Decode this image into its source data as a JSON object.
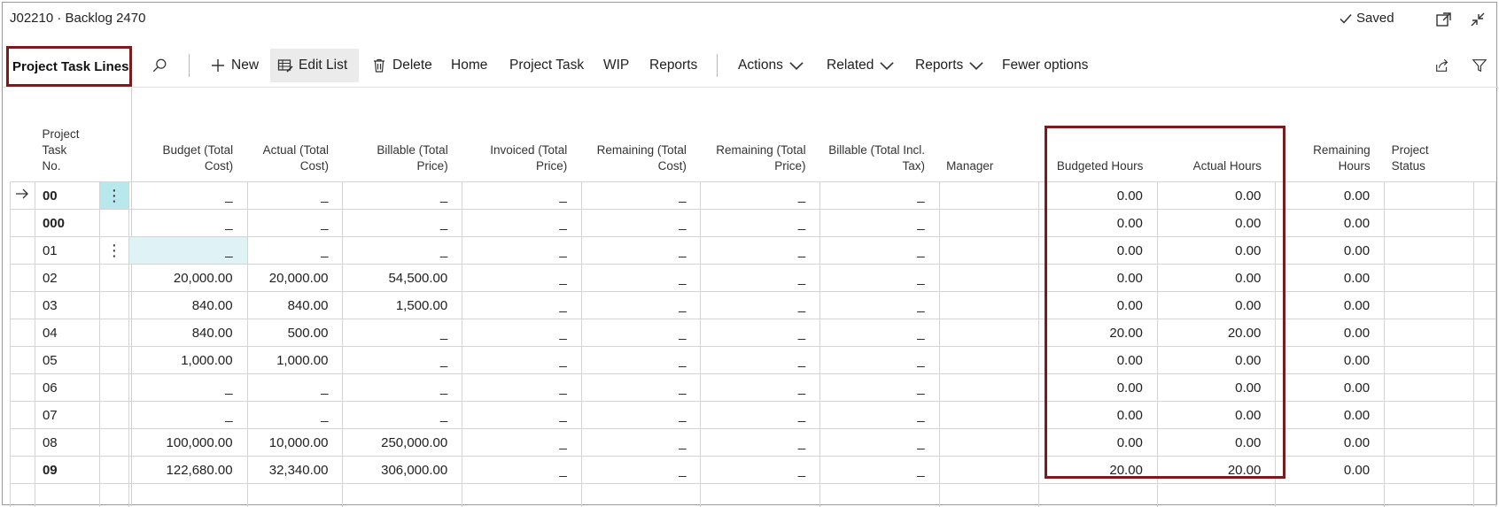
{
  "window": {
    "title": "J02210 · Backlog 2470",
    "saved_label": "Saved",
    "icons": [
      "checkmark-icon",
      "open-in-new-window-icon",
      "collapse-icon"
    ]
  },
  "actionbar": {
    "section_label": "Project Task Lines",
    "search_icon": "search-icon",
    "new_label": "New",
    "edit_list_label": "Edit List",
    "delete_label": "Delete",
    "home_label": "Home",
    "project_task_label": "Project Task",
    "wip_label": "WIP",
    "reports_label": "Reports",
    "actions_label": "Actions",
    "related_label": "Related",
    "reports_menu_label": "Reports",
    "fewer_options_label": "Fewer options",
    "share_icon": "share-icon",
    "filter_icon": "filter-icon"
  },
  "table": {
    "columns": {
      "task_no": "Project Task No.",
      "budget_cost": "Budget (Total Cost)",
      "actual_cost": "Actual (Total Cost)",
      "billable_price": "Billable (Total Price)",
      "invoiced_price": "Invoiced (Total Price)",
      "remaining_cost": "Remaining (Total Cost)",
      "remaining_price": "Remaining (Total Price)",
      "billable_incl_tax": "Billable (Total Incl. Tax)",
      "manager": "Manager",
      "budgeted_hours": "Budgeted Hours",
      "actual_hours": "Actual Hours",
      "remaining_hours": "Remaining Hours",
      "project_status": "Project Status"
    },
    "rows": [
      {
        "no": "00",
        "bold": true,
        "current": true,
        "menu": true,
        "budget": "_",
        "actual": "_",
        "billable": "_",
        "invoiced": "_",
        "rem_cost": "_",
        "rem_price": "_",
        "bill_tax": "_",
        "manager": "",
        "bud_hours": "0.00",
        "act_hours": "0.00",
        "rem_hours": "0.00",
        "status": ""
      },
      {
        "no": "000",
        "bold": true,
        "current": false,
        "menu": false,
        "budget": "_",
        "actual": "_",
        "billable": "_",
        "invoiced": "_",
        "rem_cost": "_",
        "rem_price": "_",
        "bill_tax": "_",
        "manager": "",
        "bud_hours": "0.00",
        "act_hours": "0.00",
        "rem_hours": "0.00",
        "status": ""
      },
      {
        "no": "01",
        "bold": false,
        "current": false,
        "menu": true,
        "budget": "_",
        "actual": "_",
        "billable": "_",
        "invoiced": "_",
        "rem_cost": "_",
        "rem_price": "_",
        "bill_tax": "_",
        "manager": "",
        "bud_hours": "0.00",
        "act_hours": "0.00",
        "rem_hours": "0.00",
        "status": ""
      },
      {
        "no": "02",
        "bold": false,
        "current": false,
        "menu": false,
        "budget": "20,000.00",
        "actual": "20,000.00",
        "billable": "54,500.00",
        "invoiced": "_",
        "rem_cost": "_",
        "rem_price": "_",
        "bill_tax": "_",
        "manager": "",
        "bud_hours": "0.00",
        "act_hours": "0.00",
        "rem_hours": "0.00",
        "status": ""
      },
      {
        "no": "03",
        "bold": false,
        "current": false,
        "menu": false,
        "budget": "840.00",
        "actual": "840.00",
        "billable": "1,500.00",
        "invoiced": "_",
        "rem_cost": "_",
        "rem_price": "_",
        "bill_tax": "_",
        "manager": "",
        "bud_hours": "0.00",
        "act_hours": "0.00",
        "rem_hours": "0.00",
        "status": ""
      },
      {
        "no": "04",
        "bold": false,
        "current": false,
        "menu": false,
        "budget": "840.00",
        "actual": "500.00",
        "billable": "_",
        "invoiced": "_",
        "rem_cost": "_",
        "rem_price": "_",
        "bill_tax": "_",
        "manager": "",
        "bud_hours": "20.00",
        "act_hours": "20.00",
        "rem_hours": "0.00",
        "status": ""
      },
      {
        "no": "05",
        "bold": false,
        "current": false,
        "menu": false,
        "budget": "1,000.00",
        "actual": "1,000.00",
        "billable": "_",
        "invoiced": "_",
        "rem_cost": "_",
        "rem_price": "_",
        "bill_tax": "_",
        "manager": "",
        "bud_hours": "0.00",
        "act_hours": "0.00",
        "rem_hours": "0.00",
        "status": ""
      },
      {
        "no": "06",
        "bold": false,
        "current": false,
        "menu": false,
        "budget": "_",
        "actual": "_",
        "billable": "_",
        "invoiced": "_",
        "rem_cost": "_",
        "rem_price": "_",
        "bill_tax": "_",
        "manager": "",
        "bud_hours": "0.00",
        "act_hours": "0.00",
        "rem_hours": "0.00",
        "status": ""
      },
      {
        "no": "07",
        "bold": false,
        "current": false,
        "menu": false,
        "budget": "_",
        "actual": "_",
        "billable": "_",
        "invoiced": "_",
        "rem_cost": "_",
        "rem_price": "_",
        "bill_tax": "_",
        "manager": "",
        "bud_hours": "0.00",
        "act_hours": "0.00",
        "rem_hours": "0.00",
        "status": ""
      },
      {
        "no": "08",
        "bold": false,
        "current": false,
        "menu": false,
        "budget": "100,000.00",
        "actual": "10,000.00",
        "billable": "250,000.00",
        "invoiced": "_",
        "rem_cost": "_",
        "rem_price": "_",
        "bill_tax": "_",
        "manager": "",
        "bud_hours": "0.00",
        "act_hours": "0.00",
        "rem_hours": "0.00",
        "status": ""
      },
      {
        "no": "09",
        "bold": true,
        "current": false,
        "menu": false,
        "budget": "122,680.00",
        "actual": "32,340.00",
        "billable": "306,000.00",
        "invoiced": "_",
        "rem_cost": "_",
        "rem_price": "_",
        "bill_tax": "_",
        "manager": "",
        "bud_hours": "20.00",
        "act_hours": "20.00",
        "rem_hours": "0.00",
        "status": ""
      }
    ]
  }
}
